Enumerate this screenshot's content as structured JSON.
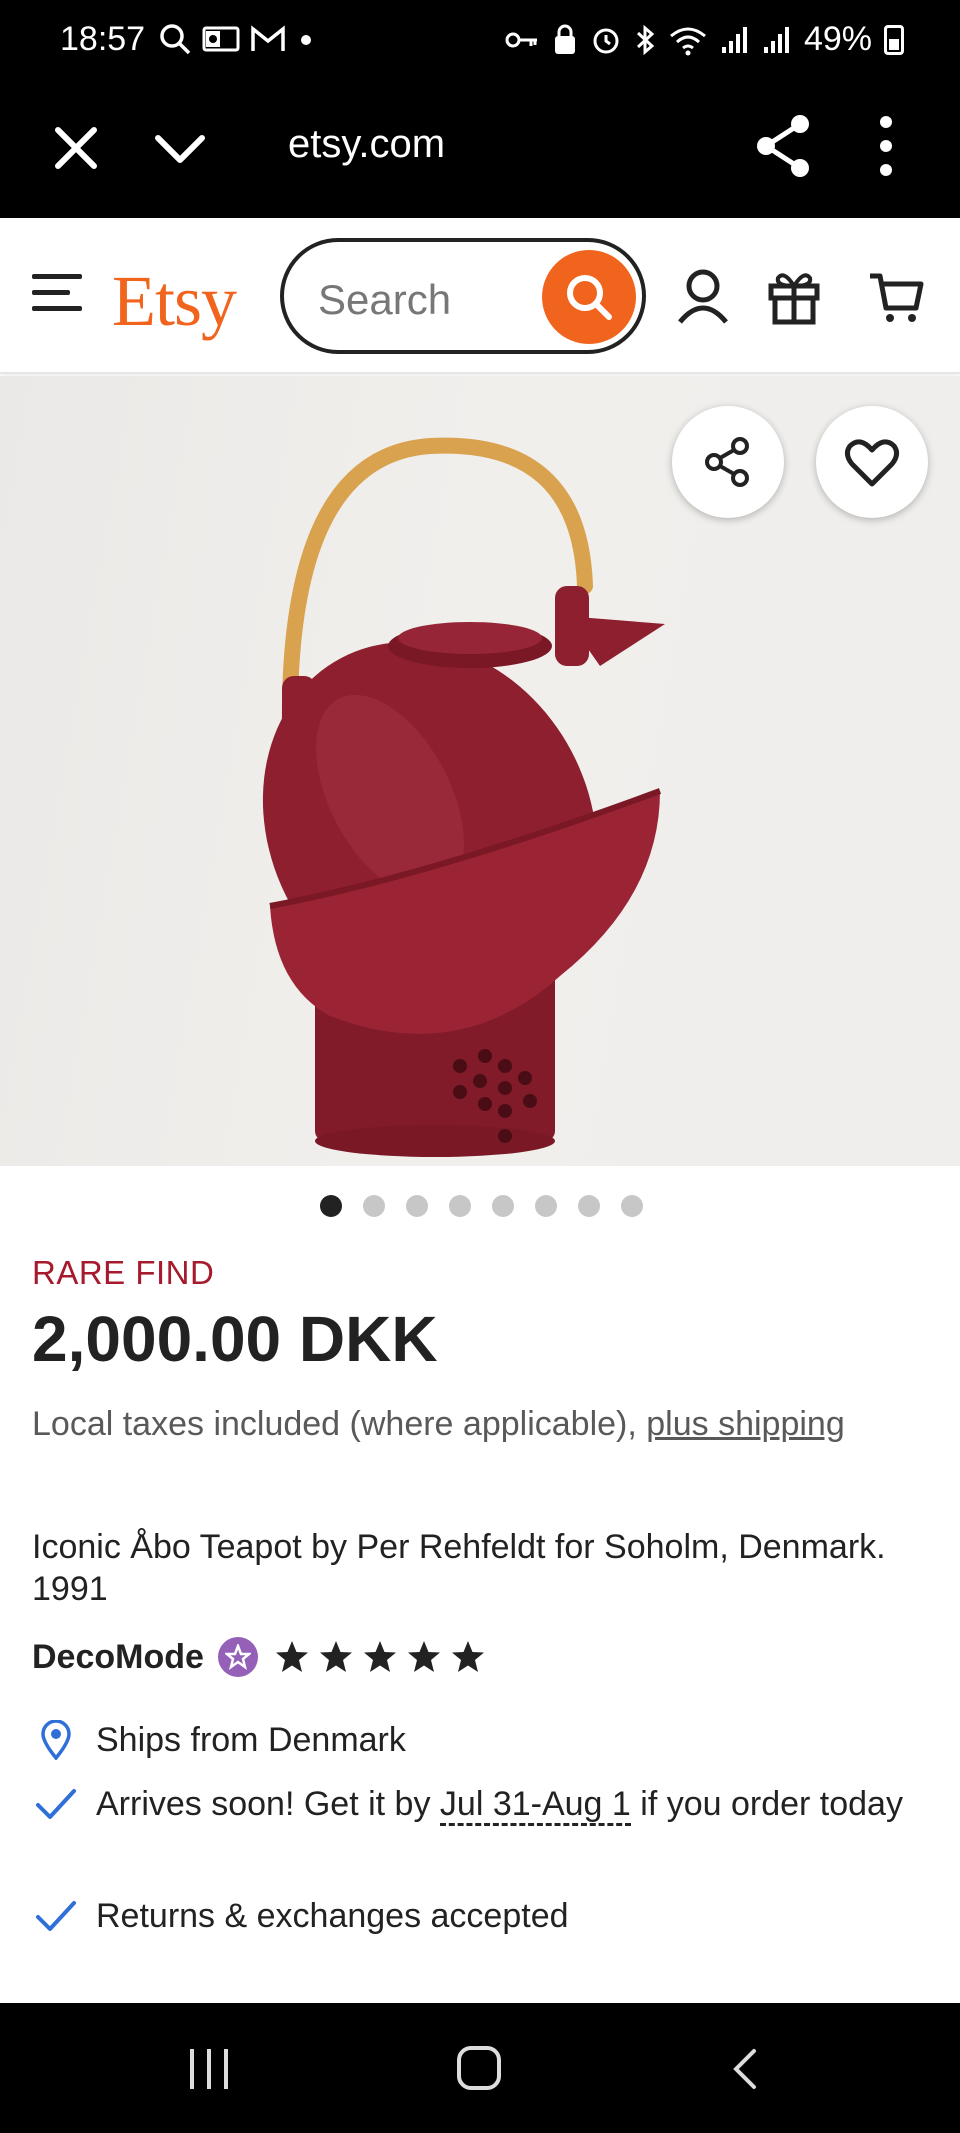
{
  "status_bar": {
    "time": "18:57",
    "battery": "49%"
  },
  "browser": {
    "url": "etsy.com"
  },
  "header": {
    "logo": "Etsy",
    "search_placeholder": "Search"
  },
  "carousel": {
    "total_images": 8,
    "active_index": 0
  },
  "product": {
    "badge": "RARE FIND",
    "price": "2,000.00 DKK",
    "tax_note": "Local taxes included (where applicable), ",
    "shipping_link": "plus shipping",
    "title": "Iconic Åbo Teapot by Per Rehfeldt for Soholm, Denmark. 1991",
    "shop_name": "DecoMode",
    "rating_stars": 5
  },
  "features": {
    "ships_from": "Ships from Denmark",
    "arrives_prefix": "Arrives soon! Get it by ",
    "arrives_date": "Jul 31-Aug 1",
    "arrives_suffix": " if you order today",
    "returns": "Returns & exchanges accepted"
  },
  "colors": {
    "etsy_orange": "#F1641E",
    "rare_red": "#A61A2E",
    "star_seller_purple": "#9560B8",
    "check_blue": "#2E6FD8",
    "teapot_red": "#8E1F2E"
  }
}
